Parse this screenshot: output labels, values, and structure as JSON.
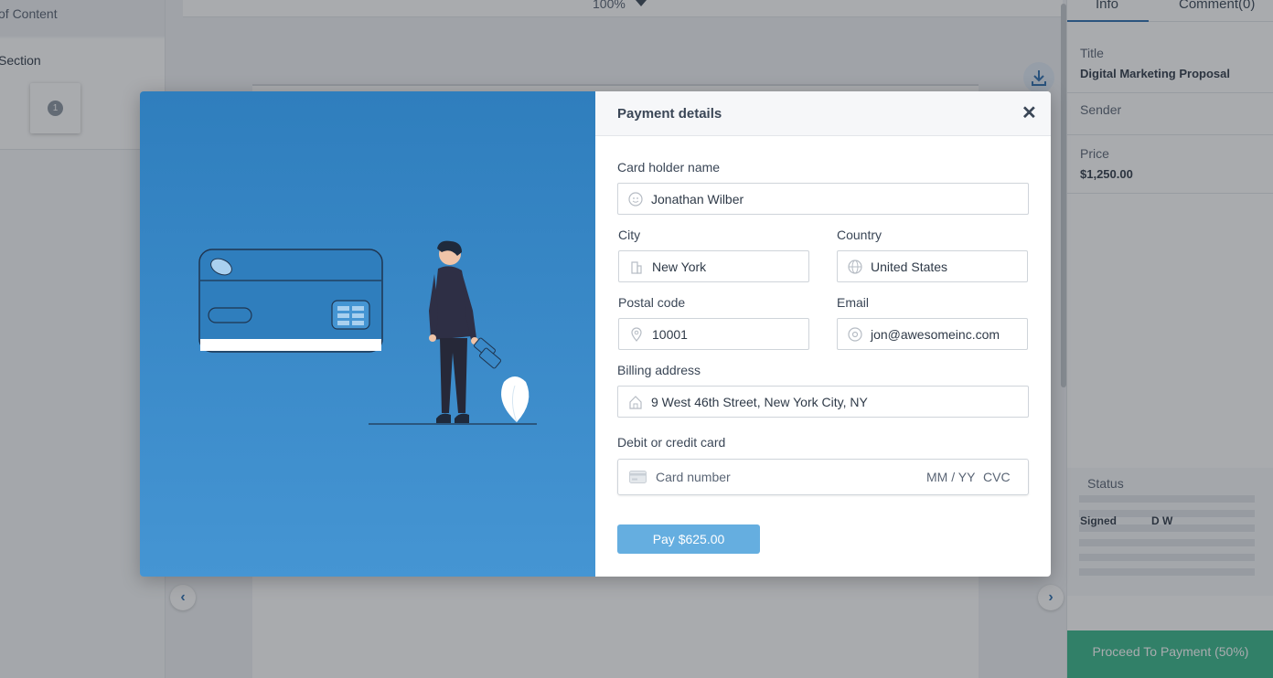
{
  "toc": {
    "header": "of Content",
    "section_label": "Section",
    "thumb_number": "1"
  },
  "viewer": {
    "zoom": "100%"
  },
  "info_panel": {
    "tabs": [
      {
        "label": "Info",
        "active": true
      },
      {
        "label": "Comment(0)",
        "active": false
      }
    ],
    "title_label": "Title",
    "title_value": "Digital Marketing Proposal",
    "sender_label": "Sender",
    "price_label": "Price",
    "price_value": "$1,250.00",
    "status_label": "Status",
    "signed_label": "Signed",
    "signer_name": "D W",
    "proceed_label": "Proceed To Payment (50%)"
  },
  "colors": {
    "accent": "#2d6fb0",
    "proceed_green": "#37b88b",
    "pay_button": "#65aee0",
    "illustration_bg": "#3a89c8"
  },
  "payment": {
    "title": "Payment details",
    "close_icon": "close-icon",
    "card_holder_label": "Card holder name",
    "card_holder_value": "Jonathan Wilber",
    "city_label": "City",
    "city_value": "New York",
    "country_label": "Country",
    "country_value": "United States",
    "postal_label": "Postal code",
    "postal_value": "10001",
    "email_label": "Email",
    "email_value": "jon@awesomeinc.com",
    "billing_label": "Billing address",
    "billing_value": "9 West 46th Street, New York City, NY",
    "card_label": "Debit or credit card",
    "card_placeholder": "Card number",
    "card_expiry_placeholder": "MM / YY",
    "card_cvc_placeholder": "CVC",
    "pay_button": "Pay  $625.00"
  }
}
